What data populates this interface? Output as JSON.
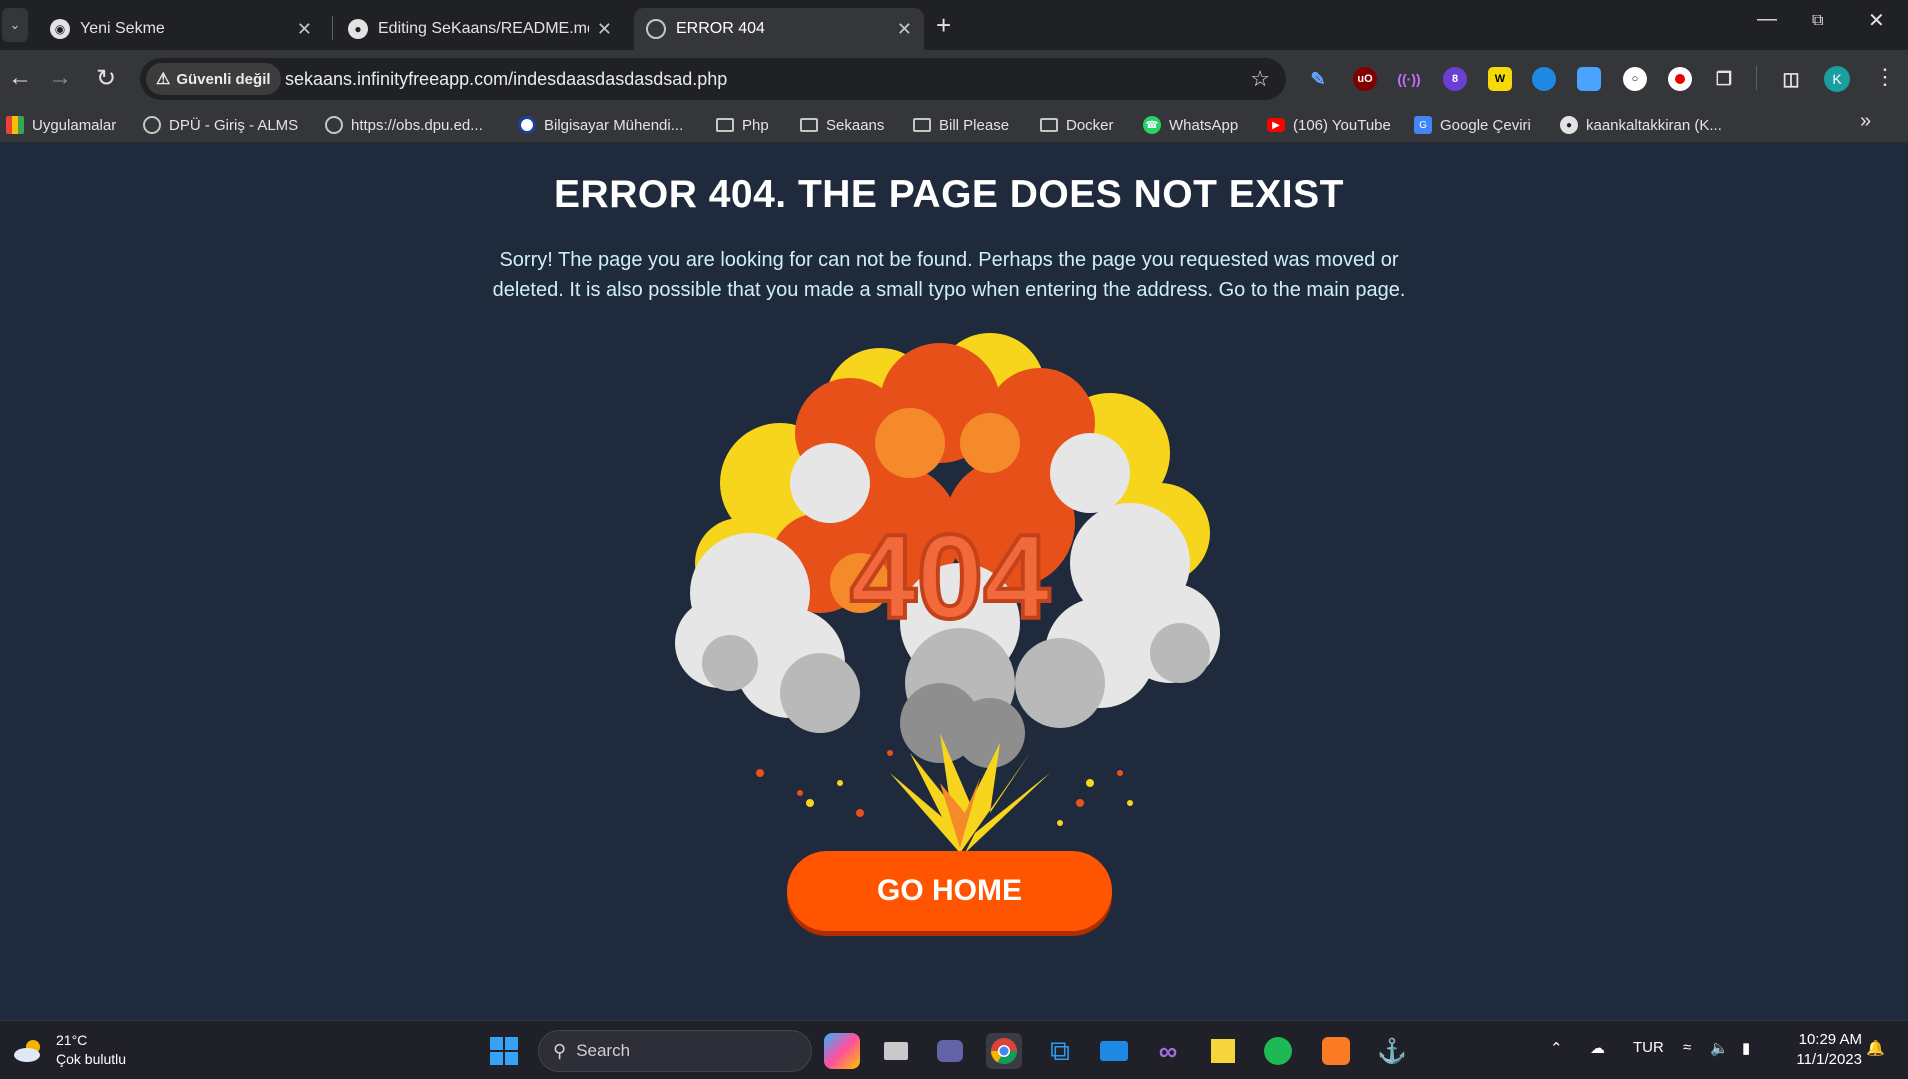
{
  "tabs": [
    {
      "title": "Yeni Sekme",
      "active": false
    },
    {
      "title": "Editing SeKaans/README.md a",
      "active": false
    },
    {
      "title": "ERROR 404",
      "active": true
    }
  ],
  "omnibox": {
    "security_label": "Güvenli değil",
    "url": "sekaans.infinityfreeapp.com/indesdaasdasdasdsad.php"
  },
  "toolbar": {
    "extension_badge": "8",
    "profile_initial": "K"
  },
  "bookmarks": [
    {
      "label": "Uygulamalar",
      "icon": "apps-grid-icon"
    },
    {
      "label": "DPÜ - Giriş - ALMS",
      "icon": "globe-icon"
    },
    {
      "label": "https://obs.dpu.ed...",
      "icon": "globe-icon"
    },
    {
      "label": "Bilgisayar Mühendi...",
      "icon": "university-icon"
    },
    {
      "label": "Php",
      "icon": "folder-icon"
    },
    {
      "label": "Sekaans",
      "icon": "folder-icon"
    },
    {
      "label": "Bill Please",
      "icon": "folder-icon"
    },
    {
      "label": "Docker",
      "icon": "folder-icon"
    },
    {
      "label": "WhatsApp",
      "icon": "whatsapp-icon"
    },
    {
      "label": "(106) YouTube",
      "icon": "youtube-icon"
    },
    {
      "label": "Google Çeviri",
      "icon": "translate-icon"
    },
    {
      "label": "kaankaltakkiran (K...",
      "icon": "github-icon"
    }
  ],
  "page": {
    "title": "ERROR 404. THE PAGE DOES NOT EXIST",
    "message": "Sorry! The page you are looking for can not be found. Perhaps the page you requested was moved or deleted. It is also possible that you made a small typo when entering the address. Go to the main page.",
    "illustration_text": "404",
    "button_label": "GO HOME"
  },
  "taskbar": {
    "weather_temp": "21°C",
    "weather_desc": "Çok bulutlu",
    "search_placeholder": "Search",
    "language": "TUR",
    "time": "10:29 AM",
    "date": "11/1/2023"
  },
  "colors": {
    "page_bg": "#1f2b3c",
    "button": "#ff5500",
    "message_text": "#cfeff7"
  }
}
